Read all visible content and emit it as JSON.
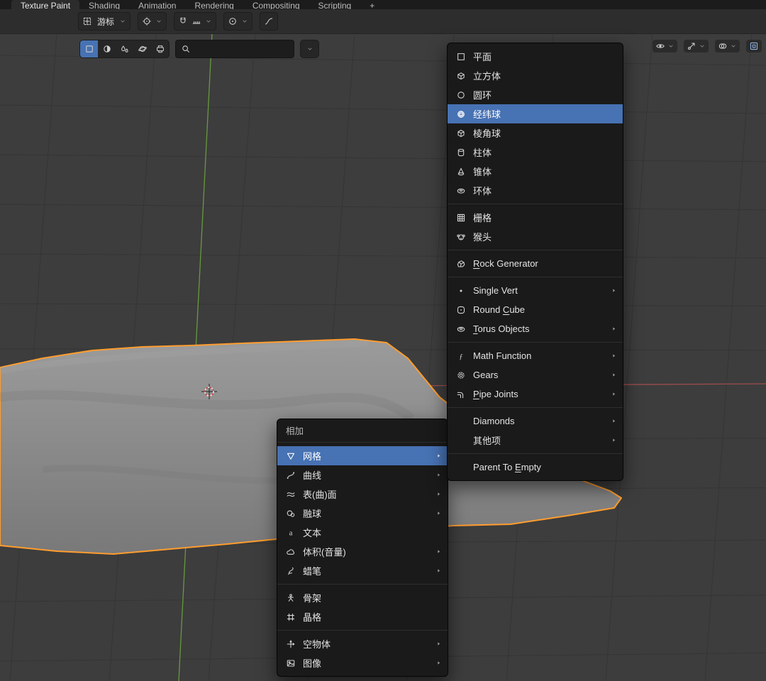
{
  "topbar": {
    "tabs": [
      {
        "key": "texture-paint",
        "label": "Texture Paint",
        "active": true
      },
      {
        "key": "shading",
        "label": "Shading"
      },
      {
        "key": "animation",
        "label": "Animation"
      },
      {
        "key": "rendering",
        "label": "Rendering"
      },
      {
        "key": "compositing",
        "label": "Compositing"
      },
      {
        "key": "scripting",
        "label": "Scripting"
      },
      {
        "key": "add-workspace",
        "label": "+"
      }
    ]
  },
  "toolbar": {
    "tool_label": "游标",
    "controls": [
      {
        "key": "tool-dropdown",
        "icon": "cursor-tool",
        "chevron": true
      },
      {
        "key": "orientation-dropdown",
        "icon": "pivot",
        "chevron": true
      },
      {
        "key": "snap-toggle",
        "icon": "magnet"
      },
      {
        "key": "snap-target-dropdown",
        "icon": "snap",
        "chevron": true
      },
      {
        "key": "proportional-dropdown",
        "icon": "prop",
        "chevron": true
      },
      {
        "key": "falloff-button",
        "icon": "falloff"
      }
    ]
  },
  "viewport_header": {
    "left_buttons": [
      {
        "key": "mode-solid",
        "icon": "square",
        "active": true
      },
      {
        "key": "mode-material",
        "icon": "sphere-half"
      },
      {
        "key": "mode-paint",
        "icon": "droplets"
      },
      {
        "key": "mode-texture",
        "icon": "sphere-ring"
      },
      {
        "key": "mode-output",
        "icon": "output"
      }
    ],
    "search": {
      "placeholder": "",
      "value": ""
    },
    "right_buttons": [
      {
        "key": "visibility-dropdown",
        "icon": "eye",
        "chevron": true
      },
      {
        "key": "gizmo-dropdown",
        "icon": "gizmo",
        "chevron": true
      },
      {
        "key": "overlays-dropdown",
        "icon": "overlays",
        "chevron": true
      },
      {
        "key": "shading-maximize",
        "icon": "maximize",
        "accent": true
      }
    ]
  },
  "add_menu": {
    "title": "相加",
    "items": [
      {
        "key": "mesh",
        "icon": "mesh",
        "label": "网格",
        "arrow": true,
        "highlighted": true
      },
      {
        "key": "curve",
        "icon": "curve",
        "label": "曲线",
        "arrow": true
      },
      {
        "key": "surface",
        "icon": "surface",
        "label": "表(曲)面",
        "arrow": true
      },
      {
        "key": "metaball",
        "icon": "metaball",
        "label": "融球",
        "arrow": true
      },
      {
        "key": "text",
        "icon": "text",
        "label": "文本"
      },
      {
        "key": "volume",
        "icon": "volume",
        "label": "体积(音量)",
        "arrow": true
      },
      {
        "key": "grease-pencil",
        "icon": "grease",
        "label": "蜡笔",
        "arrow": true
      },
      {
        "type": "sep"
      },
      {
        "key": "armature",
        "icon": "armature",
        "label": "骨架"
      },
      {
        "key": "lattice",
        "icon": "lattice",
        "label": "晶格"
      },
      {
        "type": "sep"
      },
      {
        "key": "empty",
        "icon": "empty",
        "label": "空物体",
        "arrow": true
      },
      {
        "key": "image",
        "icon": "image",
        "label": "图像",
        "arrow": true
      }
    ]
  },
  "mesh_submenu": {
    "items": [
      {
        "key": "plane",
        "icon": "plane",
        "label": "平面"
      },
      {
        "key": "cube",
        "icon": "cube",
        "label": "立方体"
      },
      {
        "key": "circle",
        "icon": "circle",
        "label": "圆环"
      },
      {
        "key": "uv-sphere",
        "icon": "uv-sphere",
        "label": "经纬球",
        "highlighted": true
      },
      {
        "key": "ico-sphere",
        "icon": "ico-sphere",
        "label": "棱角球"
      },
      {
        "key": "cylinder",
        "icon": "cylinder",
        "label": "柱体"
      },
      {
        "key": "cone",
        "icon": "cone",
        "label": "锥体"
      },
      {
        "key": "torus",
        "icon": "torus",
        "label": "环体"
      },
      {
        "type": "sep"
      },
      {
        "key": "grid",
        "icon": "grid",
        "label": "栅格"
      },
      {
        "key": "monkey",
        "icon": "monkey",
        "label": "猴头"
      },
      {
        "type": "sep"
      },
      {
        "key": "rock-generator",
        "icon": "rock",
        "label": "Rock Generator",
        "underline": 0
      },
      {
        "type": "sep"
      },
      {
        "key": "single-vert",
        "icon": "vert",
        "label": "Single Vert",
        "arrow": true
      },
      {
        "key": "round-cube",
        "icon": "round-cube",
        "label": "Round Cube",
        "underline": 6
      },
      {
        "key": "torus-objects",
        "icon": "torus-obj",
        "label": "Torus Objects",
        "arrow": true,
        "underline": 0
      },
      {
        "type": "sep"
      },
      {
        "key": "math-function",
        "icon": "math",
        "label": "Math Function",
        "arrow": true
      },
      {
        "key": "gears",
        "icon": "gears",
        "label": "Gears",
        "arrow": true
      },
      {
        "key": "pipe-joints",
        "icon": "pipe",
        "label": "Pipe Joints",
        "arrow": true,
        "underline": 0
      },
      {
        "type": "sep"
      },
      {
        "key": "diamonds",
        "label": "Diamonds",
        "arrow": true
      },
      {
        "key": "extras",
        "label": "其他项",
        "arrow": true
      },
      {
        "type": "sep"
      },
      {
        "key": "parent-to-empty",
        "label": "Parent To Empty",
        "underline": 10
      }
    ]
  },
  "colors": {
    "accent": "#4772b3",
    "selection_outline": "#ff9d2e",
    "axis_x": "#b14f4f",
    "axis_y": "#6faa3f",
    "menu_bg": "#1a1a1a",
    "viewport_bg": "#3d3d3d"
  }
}
